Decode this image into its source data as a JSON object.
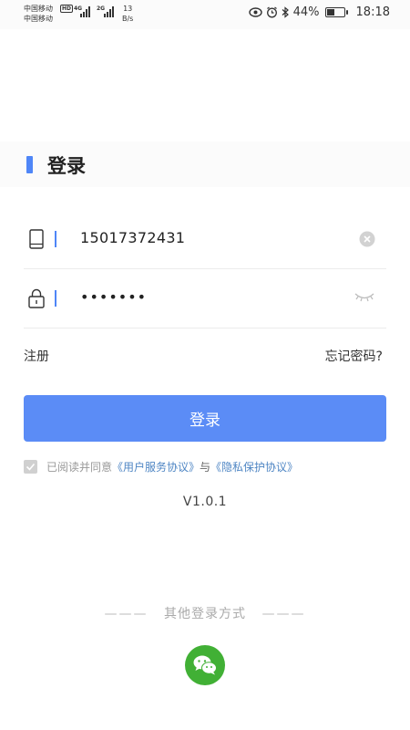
{
  "status_bar": {
    "carrier_1": "中国移动",
    "carrier_2": "中国移动",
    "hd_badge": "HD",
    "network_1": "4G",
    "network_2": "2G",
    "speed_value": "13",
    "speed_unit": "B/s",
    "battery_percent": "44%",
    "battery_level": 0.44,
    "time": "18:18",
    "icons": [
      "eye-icon",
      "alarm-icon",
      "bluetooth-icon",
      "battery-icon"
    ]
  },
  "header": {
    "title": "登录",
    "accent_color": "#4f86f7"
  },
  "form": {
    "phone": {
      "value": "15017372431",
      "icon": "phone-icon",
      "clear_icon": "clear-icon"
    },
    "password": {
      "value": "•••••••",
      "icon": "lock-icon",
      "toggle_icon": "eye-closed-icon"
    }
  },
  "links": {
    "register": "注册",
    "forgot_password": "忘记密码?"
  },
  "login_button": {
    "label": "登录",
    "color": "#5b8cf6"
  },
  "agreement": {
    "checked": true,
    "prefix": "已阅读并同意",
    "user_agreement": "《用户服务协议》",
    "conjunction": "与",
    "privacy_agreement": "《隐私保护协议》"
  },
  "version": "V1.0.1",
  "other_login": {
    "dash_left": "———",
    "label": "其他登录方式",
    "dash_right": "———",
    "wechat_icon": "wechat-icon",
    "wechat_color": "#41b035"
  }
}
